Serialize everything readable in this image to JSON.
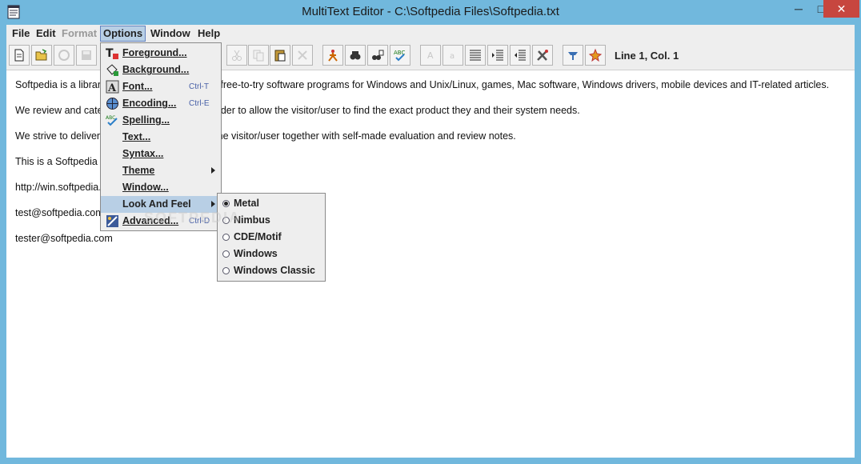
{
  "window": {
    "title": "MultiText Editor - C:\\Softpedia Files\\Softpedia.txt",
    "minimize": "─",
    "maximize": "□",
    "close": "✕"
  },
  "menubar": {
    "items": [
      {
        "label": "File",
        "enabled": true
      },
      {
        "label": "Edit",
        "enabled": true
      },
      {
        "label": "Format",
        "enabled": false
      },
      {
        "label": "Options",
        "enabled": true,
        "active": true
      },
      {
        "label": "Window",
        "enabled": true
      },
      {
        "label": "Help",
        "enabled": true
      }
    ]
  },
  "toolbar": {
    "buttons": [
      {
        "icon": "new-file-icon",
        "enabled": true
      },
      {
        "icon": "open-folder-icon",
        "enabled": true
      },
      {
        "icon": "reload-icon",
        "enabled": false
      },
      {
        "icon": "save-icon",
        "enabled": false
      },
      {
        "icon": "cut-icon",
        "enabled": false
      },
      {
        "icon": "copy-icon",
        "enabled": false
      },
      {
        "icon": "paste-icon",
        "enabled": true
      },
      {
        "icon": "delete-icon",
        "enabled": false
      },
      {
        "icon": "goto-icon",
        "enabled": true
      },
      {
        "icon": "find-icon",
        "enabled": true
      },
      {
        "icon": "replace-icon",
        "enabled": true
      },
      {
        "icon": "spellcheck-icon",
        "enabled": true
      },
      {
        "icon": "uppercase-icon",
        "enabled": false
      },
      {
        "icon": "lowercase-icon",
        "enabled": false
      },
      {
        "icon": "align-icon",
        "enabled": true
      },
      {
        "icon": "indent-icon",
        "enabled": true
      },
      {
        "icon": "unindent-icon",
        "enabled": true
      },
      {
        "icon": "tools-icon",
        "enabled": true
      },
      {
        "icon": "help-icon",
        "enabled": true
      },
      {
        "icon": "about-icon",
        "enabled": true
      }
    ],
    "position_label": "Line 1, Col. 1"
  },
  "editor": {
    "lines": [
      "Softpedia is a library of over 400,000 free and free-to-try software programs for Windows and Unix/Linux, games, Mac software, Windows drivers, mobile devices and IT-related articles.",
      "We review and categorize these products in order to allow the visitor/user to find the exact product they and their system needs.",
      "We strive to deliver only the best products to the visitor/user together with self-made evaluation and review notes.",
      "This is a Softpedia test file.",
      "http://win.softpedia.com",
      "test@softpedia.com",
      "tester@softpedia.com"
    ]
  },
  "options_menu": {
    "items": [
      {
        "label": "Foreground...",
        "icon": "foreground-icon",
        "accel": ""
      },
      {
        "label": "Background...",
        "icon": "background-icon",
        "accel": ""
      },
      {
        "label": "Font...",
        "icon": "font-icon",
        "accel": "Ctrl-T"
      },
      {
        "label": "Encoding...",
        "icon": "encoding-icon",
        "accel": "Ctrl-E"
      },
      {
        "label": "Spelling...",
        "icon": "spelling-icon",
        "accel": ""
      },
      {
        "label": "Text...",
        "icon": "",
        "accel": ""
      },
      {
        "label": "Syntax...",
        "icon": "",
        "accel": ""
      },
      {
        "label": "Theme",
        "icon": "",
        "accel": "",
        "submenu": true
      },
      {
        "label": "Window...",
        "icon": "",
        "accel": ""
      },
      {
        "label": "Look And Feel",
        "icon": "",
        "accel": "",
        "submenu": true,
        "highlighted": true
      },
      {
        "label": "Advanced...",
        "icon": "advanced-icon",
        "accel": "Ctrl-D"
      }
    ]
  },
  "look_and_feel_menu": {
    "items": [
      {
        "label": "Metal",
        "selected": true
      },
      {
        "label": "Nimbus",
        "selected": false
      },
      {
        "label": "CDE/Motif",
        "selected": false
      },
      {
        "label": "Windows",
        "selected": false
      },
      {
        "label": "Windows Classic",
        "selected": false
      }
    ]
  },
  "watermark": "SOFTPEDIA"
}
